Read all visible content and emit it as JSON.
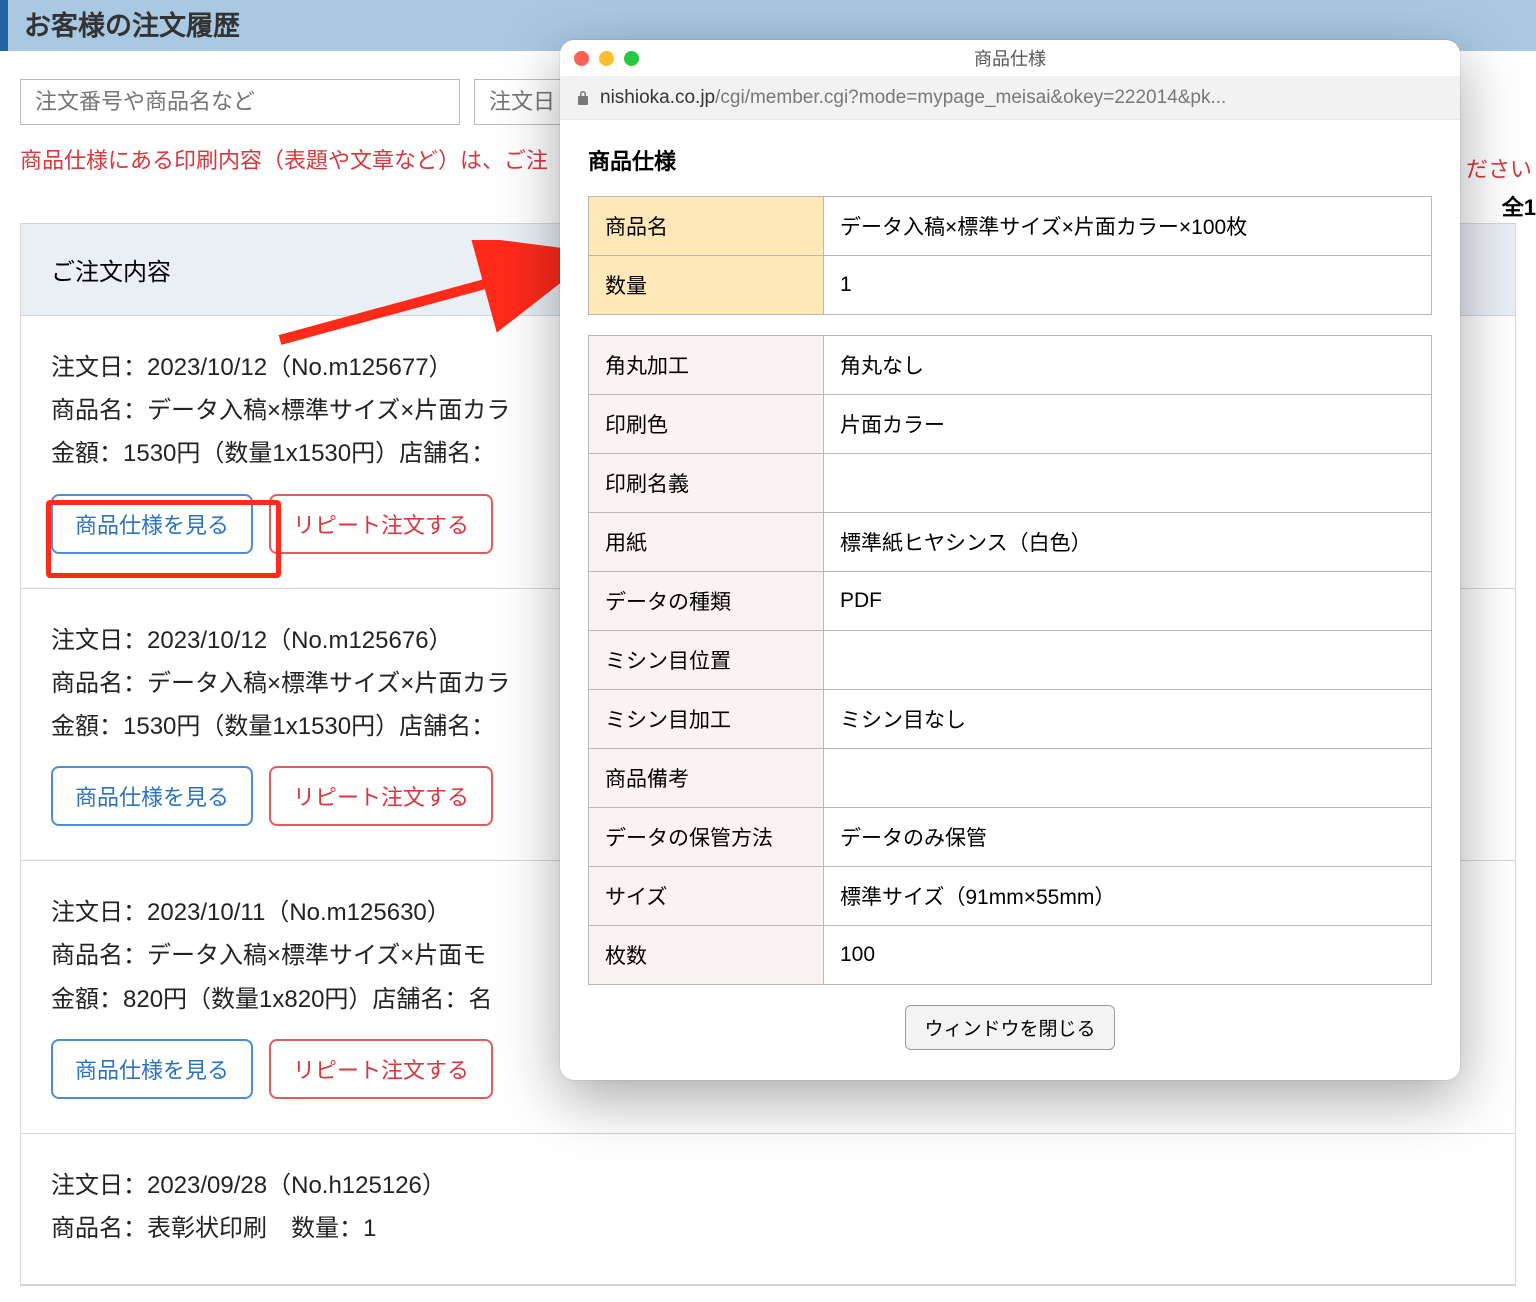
{
  "page": {
    "title": "お客様の注文履歴",
    "search_placeholder": "注文番号や商品名など",
    "date_placeholder": "注文日",
    "warning": "商品仕様にある印刷内容（表題や文章など）は、ご注",
    "warning_tail": "ださい",
    "count_prefix": "全1",
    "orders_heading": "ご注文内容"
  },
  "orders": [
    {
      "line1": "注文日：2023/10/12（No.m125677）",
      "line2": "商品名：データ入稿×標準サイズ×片面カラ",
      "line3": "金額：1530円（数量1x1530円）店舗名：",
      "btn_spec": "商品仕様を見る",
      "btn_repeat": "リピート注文する"
    },
    {
      "line1": "注文日：2023/10/12（No.m125676）",
      "line2": "商品名：データ入稿×標準サイズ×片面カラ",
      "line3": "金額：1530円（数量1x1530円）店舗名：",
      "btn_spec": "商品仕様を見る",
      "btn_repeat": "リピート注文する"
    },
    {
      "line1": "注文日：2023/10/11（No.m125630）",
      "line2": "商品名：データ入稿×標準サイズ×片面モ",
      "line3": "金額：820円（数量1x820円）店舗名：名",
      "btn_spec": "商品仕様を見る",
      "btn_repeat": "リピート注文する"
    },
    {
      "line1": "注文日：2023/09/28（No.h125126）",
      "line2": "商品名：表彰状印刷　数量：1"
    }
  ],
  "popup": {
    "window_title": "商品仕様",
    "url_host": "nishioka.co.jp",
    "url_path": "/cgi/member.cgi?mode=mypage_meisai&okey=222014&pk...",
    "heading": "商品仕様",
    "head_rows": [
      {
        "k": "商品名",
        "v": "データ入稿×標準サイズ×片面カラー×100枚"
      },
      {
        "k": "数量",
        "v": "1"
      }
    ],
    "body_rows": [
      {
        "k": "角丸加工",
        "v": "角丸なし"
      },
      {
        "k": "印刷色",
        "v": "片面カラー"
      },
      {
        "k": "印刷名義",
        "v": ""
      },
      {
        "k": "用紙",
        "v": "標準紙ヒヤシンス（白色）"
      },
      {
        "k": "データの種類",
        "v": "PDF"
      },
      {
        "k": "ミシン目位置",
        "v": ""
      },
      {
        "k": "ミシン目加工",
        "v": "ミシン目なし"
      },
      {
        "k": "商品備考",
        "v": ""
      },
      {
        "k": "データの保管方法",
        "v": "データのみ保管"
      },
      {
        "k": "サイズ",
        "v": "標準サイズ（91mm×55mm）"
      },
      {
        "k": "枚数",
        "v": "100"
      }
    ],
    "close_label": "ウィンドウを閉じる"
  }
}
